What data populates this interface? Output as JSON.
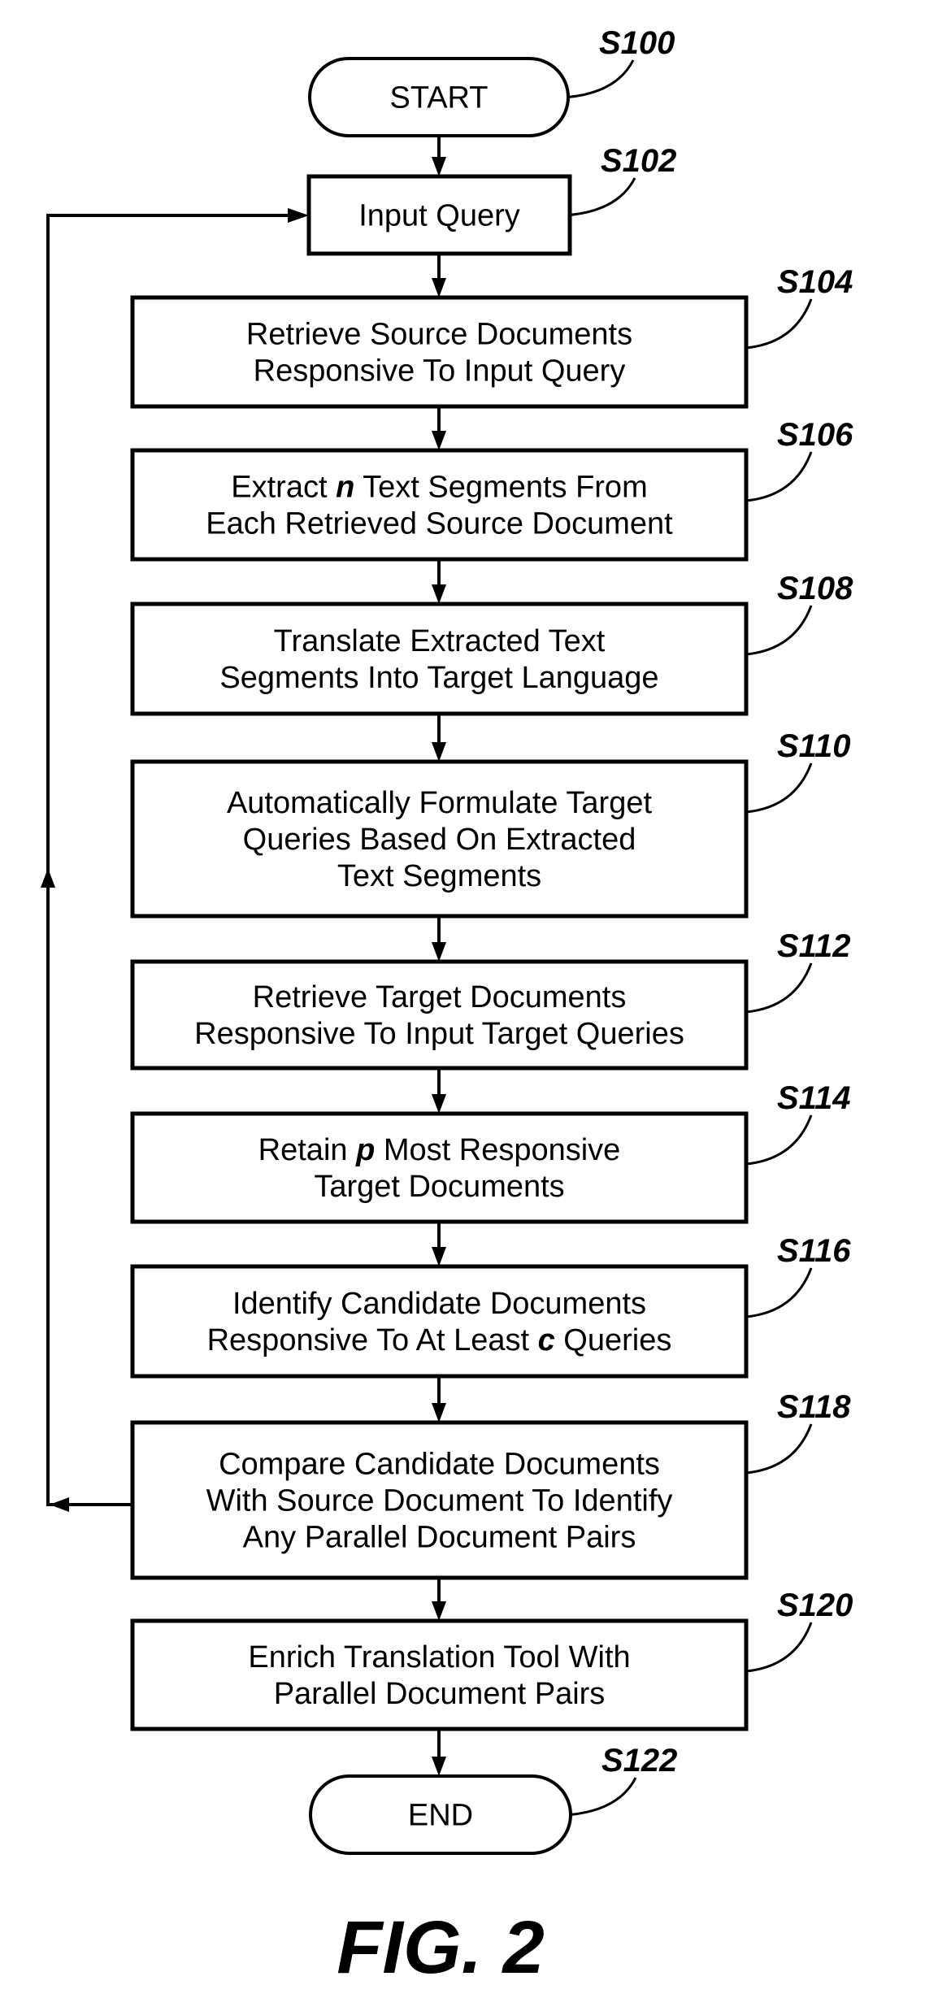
{
  "figure": {
    "caption": "FIG. 2",
    "steps": [
      {
        "id": "S100",
        "kind": "terminal",
        "lines": [
          [
            {
              "t": "START"
            }
          ]
        ]
      },
      {
        "id": "S102",
        "kind": "process",
        "lines": [
          [
            {
              "t": "Input Query"
            }
          ]
        ]
      },
      {
        "id": "S104",
        "kind": "process",
        "lines": [
          [
            {
              "t": "Retrieve Source Documents"
            }
          ],
          [
            {
              "t": "Responsive To Input Query"
            }
          ]
        ]
      },
      {
        "id": "S106",
        "kind": "process",
        "lines": [
          [
            {
              "t": "Extract "
            },
            {
              "t": "n",
              "var": true
            },
            {
              "t": " Text Segments From"
            }
          ],
          [
            {
              "t": "Each Retrieved Source Document"
            }
          ]
        ]
      },
      {
        "id": "S108",
        "kind": "process",
        "lines": [
          [
            {
              "t": "Translate Extracted Text"
            }
          ],
          [
            {
              "t": "Segments Into Target Language"
            }
          ]
        ]
      },
      {
        "id": "S110",
        "kind": "process",
        "lines": [
          [
            {
              "t": "Automatically Formulate Target"
            }
          ],
          [
            {
              "t": "Queries Based On Extracted"
            }
          ],
          [
            {
              "t": "Text Segments"
            }
          ]
        ]
      },
      {
        "id": "S112",
        "kind": "process",
        "lines": [
          [
            {
              "t": "Retrieve Target Documents"
            }
          ],
          [
            {
              "t": "Responsive To Input Target Queries"
            }
          ]
        ]
      },
      {
        "id": "S114",
        "kind": "process",
        "lines": [
          [
            {
              "t": "Retain "
            },
            {
              "t": "p",
              "var": true
            },
            {
              "t": " Most Responsive"
            }
          ],
          [
            {
              "t": "Target Documents"
            }
          ]
        ]
      },
      {
        "id": "S116",
        "kind": "process",
        "lines": [
          [
            {
              "t": "Identify Candidate Documents"
            }
          ],
          [
            {
              "t": "Responsive To At Least "
            },
            {
              "t": "c",
              "var": true
            },
            {
              "t": " Queries"
            }
          ]
        ]
      },
      {
        "id": "S118",
        "kind": "process",
        "lines": [
          [
            {
              "t": "Compare Candidate Documents"
            }
          ],
          [
            {
              "t": "With Source Document To Identify"
            }
          ],
          [
            {
              "t": "Any Parallel Document Pairs"
            }
          ]
        ]
      },
      {
        "id": "S120",
        "kind": "process",
        "lines": [
          [
            {
              "t": "Enrich Translation Tool With"
            }
          ],
          [
            {
              "t": "Parallel Document Pairs"
            }
          ]
        ]
      },
      {
        "id": "S122",
        "kind": "terminal",
        "lines": [
          [
            {
              "t": "END"
            }
          ]
        ]
      }
    ],
    "flow": [
      [
        "S100",
        "S102"
      ],
      [
        "S102",
        "S104"
      ],
      [
        "S104",
        "S106"
      ],
      [
        "S106",
        "S108"
      ],
      [
        "S108",
        "S110"
      ],
      [
        "S110",
        "S112"
      ],
      [
        "S112",
        "S114"
      ],
      [
        "S114",
        "S116"
      ],
      [
        "S116",
        "S118"
      ],
      [
        "S118",
        "S120"
      ],
      [
        "S120",
        "S122"
      ]
    ],
    "loop": {
      "from": "S118",
      "to": "S102"
    }
  }
}
